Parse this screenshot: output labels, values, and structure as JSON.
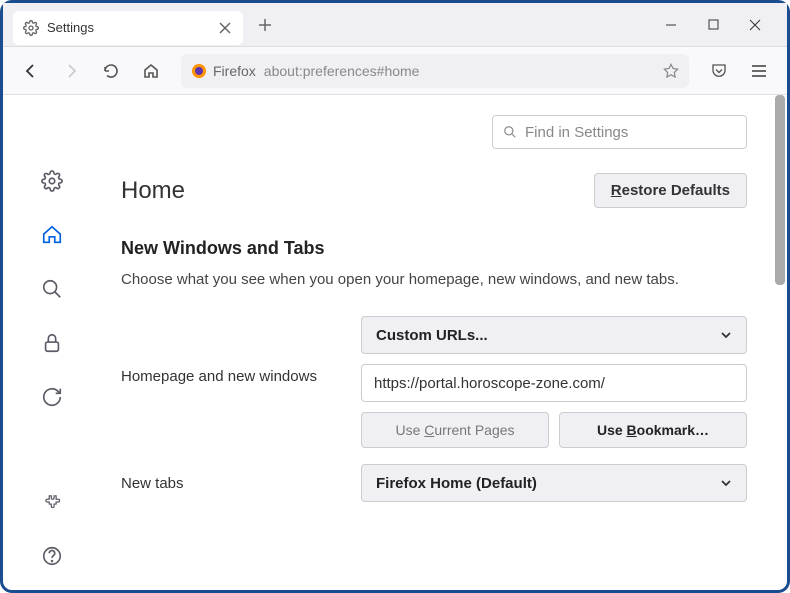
{
  "tab": {
    "title": "Settings"
  },
  "urlbar": {
    "identity": "Firefox",
    "url": "about:preferences#home"
  },
  "search": {
    "placeholder": "Find in Settings"
  },
  "page": {
    "title": "Home",
    "restore_label": "Restore Defaults"
  },
  "section": {
    "title": "New Windows and Tabs",
    "desc": "Choose what you see when you open your homepage, new windows, and new tabs."
  },
  "homepage": {
    "label": "Homepage and new windows",
    "select": "Custom URLs...",
    "url": "https://portal.horoscope-zone.com/",
    "use_current": "Use Current Pages",
    "use_bookmark": "Use Bookmark…"
  },
  "newtabs": {
    "label": "New tabs",
    "select": "Firefox Home (Default)"
  }
}
